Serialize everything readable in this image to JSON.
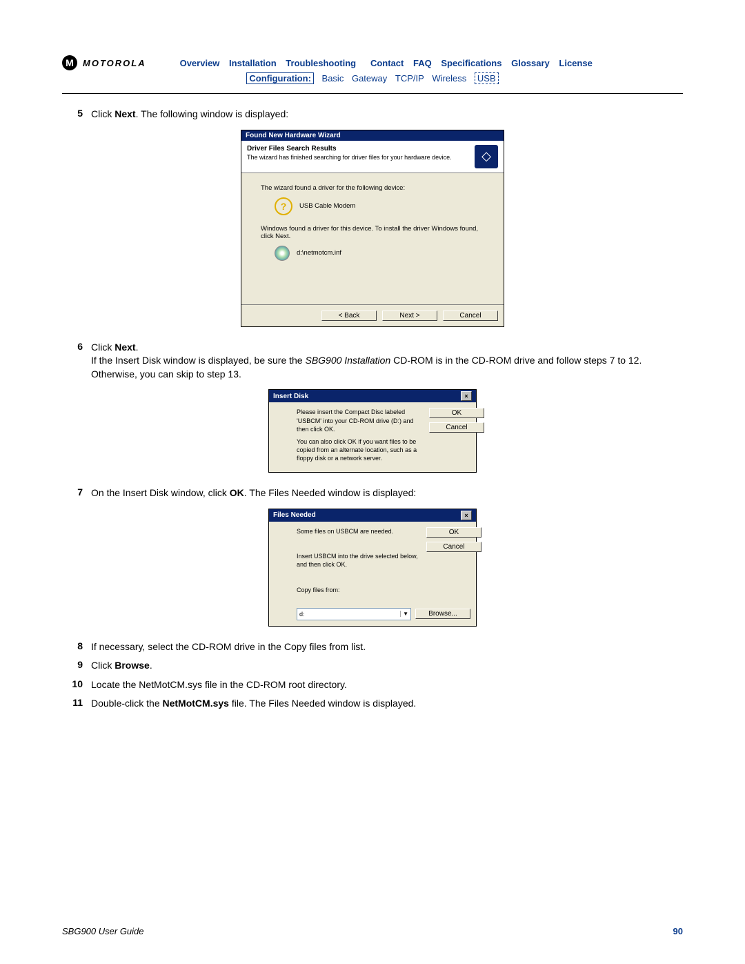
{
  "brand": {
    "logo_letter": "M",
    "name": "MOTOROLA"
  },
  "nav_top": [
    "Overview",
    "Installation",
    "Troubleshooting",
    "Contact",
    "FAQ",
    "Specifications",
    "Glossary",
    "License"
  ],
  "nav_sub": {
    "primary": "Configuration:",
    "items": [
      "Basic",
      "Gateway",
      "TCP/IP",
      "Wireless"
    ],
    "active": "USB"
  },
  "steps": {
    "s5": {
      "num": "5",
      "pre": "Click ",
      "bold": "Next",
      "post": ". The following window is displayed:"
    },
    "s6": {
      "num": "6",
      "pre": "Click ",
      "bold": "Next",
      "post": ".",
      "para_pre": "If the Insert Disk window is displayed, be sure the ",
      "para_em": "SBG900 Installation",
      "para_post": " CD-ROM is in the CD-ROM drive and follow steps 7 to 12. Otherwise, you can skip to step 13."
    },
    "s7": {
      "num": "7",
      "pre": "On the Insert Disk window, click ",
      "bold": "OK",
      "post": ". The Files Needed window is displayed:"
    },
    "s8": {
      "num": "8",
      "text": "If necessary, select the CD-ROM drive in the Copy files from list."
    },
    "s9": {
      "num": "9",
      "pre": "Click ",
      "bold": "Browse",
      "post": "."
    },
    "s10": {
      "num": "10",
      "text": "Locate the NetMotCM.sys file in the CD-ROM root directory."
    },
    "s11": {
      "num": "11",
      "pre": "Double-click the ",
      "bold": "NetMotCM.sys",
      "post": " file. The Files Needed window is displayed."
    }
  },
  "wizard": {
    "title": "Found New Hardware Wizard",
    "h1": "Driver Files Search Results",
    "h2": "The wizard has finished searching for driver files for your hardware device.",
    "line1": "The wizard found a driver for the following device:",
    "device": "USB Cable Modem",
    "line2": "Windows found a driver for this device. To install the driver Windows found, click Next.",
    "path": "d:\\netmotcm.inf",
    "btn_back": "< Back",
    "btn_next": "Next >",
    "btn_cancel": "Cancel"
  },
  "insert_disk": {
    "title": "Insert Disk",
    "p1": "Please insert the Compact Disc labeled 'USBCM' into your CD-ROM drive (D:) and then click OK.",
    "p2": "You can also click OK if you want files to be copied from an alternate location, such as a floppy disk or a network server.",
    "btn_ok": "OK",
    "btn_cancel": "Cancel"
  },
  "files_needed": {
    "title": "Files Needed",
    "p1": "Some files on USBCM are needed.",
    "p2": "Insert USBCM into the drive selected below, and then click OK.",
    "label": "Copy files from:",
    "input_value": "d:",
    "btn_ok": "OK",
    "btn_cancel": "Cancel",
    "btn_browse": "Browse..."
  },
  "footer": {
    "guide": "SBG900 User Guide",
    "page": "90"
  }
}
